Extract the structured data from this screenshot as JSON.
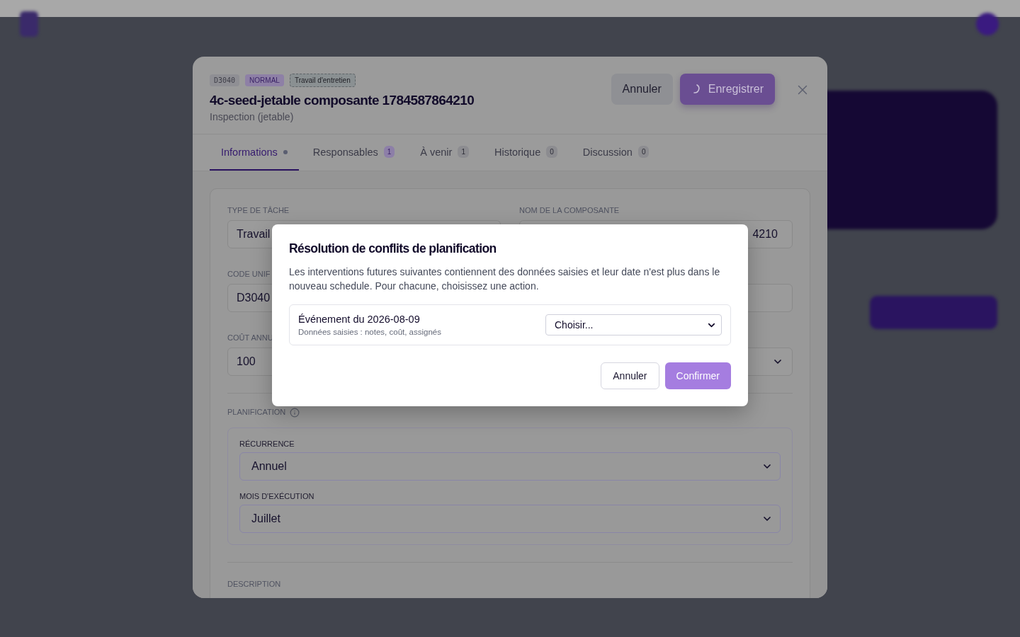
{
  "editor": {
    "badges": [
      {
        "text": "D3040",
        "kind": "code"
      },
      {
        "text": "NORMAL",
        "kind": "priority"
      },
      {
        "text": "Travail d'entretien",
        "kind": "type"
      }
    ],
    "title": "4c-seed-jetable composante 1784587864210",
    "subtitle": "Inspection (jetable)",
    "actions": [
      {
        "label": "Annuler",
        "kind": "secondary",
        "loading": false
      },
      {
        "label": "Enregistrer",
        "kind": "primary",
        "loading": true
      }
    ],
    "tabs": [
      {
        "label": "Informations",
        "selected": true,
        "dot": true
      },
      {
        "label": "Responsables",
        "selected": false,
        "dot": false,
        "count": "1",
        "highlighted": true
      },
      {
        "label": "À venir",
        "selected": false,
        "dot": false,
        "count": "1",
        "highlighted": false
      },
      {
        "label": "Historique",
        "selected": false,
        "dot": false,
        "count": "0",
        "highlighted": false
      },
      {
        "label": "Discussion",
        "selected": false,
        "dot": false,
        "count": "0",
        "highlighted": false
      }
    ],
    "fields": [
      {
        "label": "TYPE DE TÂCHE",
        "value": "Travail",
        "kind": "input"
      },
      {
        "label": "NOM DE LA COMPOSANTE",
        "value": "4210",
        "kind": "input-tail"
      },
      {
        "label": "CODE UNIF",
        "value": "D3040",
        "kind": "input"
      },
      {
        "kind": "input"
      },
      {
        "label": "COÛT ANNU",
        "value": "100",
        "kind": "input"
      },
      {
        "kind": "select"
      }
    ],
    "planning": {
      "label": "PLANIFICATION",
      "fields": [
        {
          "label": "RÉCURRENCE",
          "value": "Annuel"
        },
        {
          "label": "MOIS D'EXÉCUTION",
          "value": "Juillet"
        }
      ]
    },
    "description_label": "DESCRIPTION"
  },
  "dialog": {
    "title": "Résolution de conflits de planification",
    "text": "Les interventions futures suivantes contiennent des données saisies et leur date n'est plus dans le nouveau schedule. Pour chacune, choisissez une action.",
    "events": [
      {
        "title": "Événement du 2026-08-09",
        "detail": "Données saisies : notes, coût, assignés",
        "action": "Choisir..."
      }
    ],
    "buttons": [
      {
        "label": "Annuler",
        "kind": "secondary"
      },
      {
        "label": "Confirmer",
        "kind": "primary"
      }
    ]
  }
}
